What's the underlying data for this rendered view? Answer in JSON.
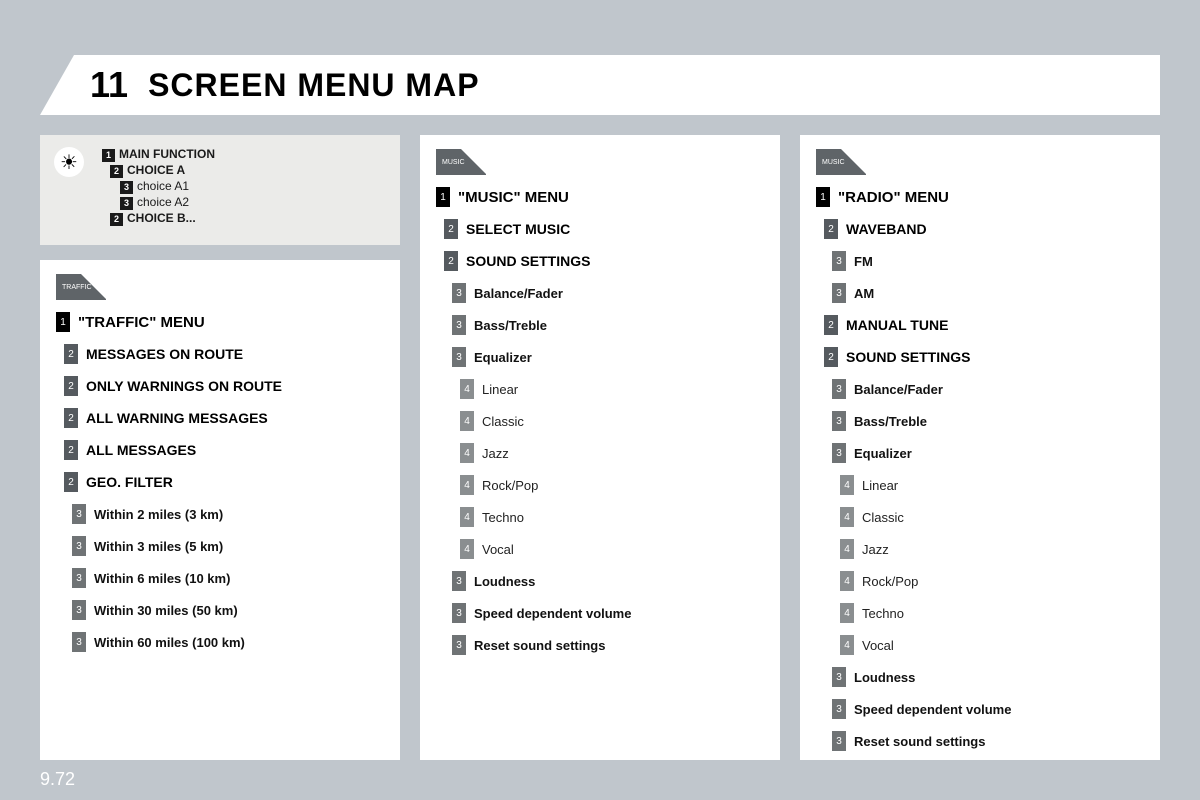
{
  "header": {
    "number": "11",
    "title": "SCREEN MENU MAP"
  },
  "legend": {
    "lines": [
      {
        "tag": "1",
        "text": "MAIN FUNCTION",
        "cls": ""
      },
      {
        "tag": "2",
        "text": "CHOICE A",
        "cls": "d2"
      },
      {
        "tag": "3",
        "text": "choice A1",
        "cls": "d3 leg3"
      },
      {
        "tag": "3",
        "text": "choice A2",
        "cls": "d3 leg3"
      },
      {
        "tag": "2",
        "text": "CHOICE B...",
        "cls": "d2"
      }
    ]
  },
  "panels": {
    "left": {
      "icon_label": "TRAFFIC",
      "items": [
        {
          "lvl": 1,
          "text": "\"TRAFFIC\" MENU",
          "style": "title"
        },
        {
          "lvl": 2,
          "text": "MESSAGES ON ROUTE",
          "style": "bold"
        },
        {
          "lvl": 2,
          "text": "ONLY WARNINGS ON ROUTE",
          "style": "bold"
        },
        {
          "lvl": 2,
          "text": "ALL WARNING MESSAGES",
          "style": "bold"
        },
        {
          "lvl": 2,
          "text": "ALL MESSAGES",
          "style": "bold"
        },
        {
          "lvl": 2,
          "text": "GEO. FILTER",
          "style": "bold"
        },
        {
          "lvl": 3,
          "text": "Within 2 miles (3 km)",
          "style": "sub"
        },
        {
          "lvl": 3,
          "text": "Within 3 miles (5 km)",
          "style": "sub"
        },
        {
          "lvl": 3,
          "text": "Within 6 miles (10 km)",
          "style": "sub"
        },
        {
          "lvl": 3,
          "text": "Within 30 miles (50 km)",
          "style": "sub"
        },
        {
          "lvl": 3,
          "text": "Within 60 miles (100 km)",
          "style": "sub"
        }
      ]
    },
    "mid": {
      "icon_label": "MUSIC",
      "items": [
        {
          "lvl": 1,
          "text": "\"MUSIC\" MENU",
          "style": "title"
        },
        {
          "lvl": 2,
          "text": "SELECT MUSIC",
          "style": "bold"
        },
        {
          "lvl": 2,
          "text": "SOUND SETTINGS",
          "style": "bold"
        },
        {
          "lvl": 3,
          "text": "Balance/Fader",
          "style": "sub"
        },
        {
          "lvl": 3,
          "text": "Bass/Treble",
          "style": "sub"
        },
        {
          "lvl": 3,
          "text": "Equalizer",
          "style": "sub"
        },
        {
          "lvl": 4,
          "text": "Linear",
          "style": "thin"
        },
        {
          "lvl": 4,
          "text": "Classic",
          "style": "thin"
        },
        {
          "lvl": 4,
          "text": "Jazz",
          "style": "thin"
        },
        {
          "lvl": 4,
          "text": "Rock/Pop",
          "style": "thin"
        },
        {
          "lvl": 4,
          "text": "Techno",
          "style": "thin"
        },
        {
          "lvl": 4,
          "text": "Vocal",
          "style": "thin"
        },
        {
          "lvl": 3,
          "text": "Loudness",
          "style": "sub"
        },
        {
          "lvl": 3,
          "text": "Speed dependent volume",
          "style": "sub"
        },
        {
          "lvl": 3,
          "text": "Reset sound settings",
          "style": "sub"
        }
      ]
    },
    "right": {
      "icon_label": "MUSIC",
      "items": [
        {
          "lvl": 1,
          "text": "\"RADIO\" MENU",
          "style": "title"
        },
        {
          "lvl": 2,
          "text": "WAVEBAND",
          "style": "bold"
        },
        {
          "lvl": 3,
          "text": "FM",
          "style": "sub"
        },
        {
          "lvl": 3,
          "text": "AM",
          "style": "sub"
        },
        {
          "lvl": 2,
          "text": "MANUAL TUNE",
          "style": "bold"
        },
        {
          "lvl": 2,
          "text": "SOUND SETTINGS",
          "style": "bold"
        },
        {
          "lvl": 3,
          "text": "Balance/Fader",
          "style": "sub"
        },
        {
          "lvl": 3,
          "text": "Bass/Treble",
          "style": "sub"
        },
        {
          "lvl": 3,
          "text": "Equalizer",
          "style": "sub"
        },
        {
          "lvl": 4,
          "text": "Linear",
          "style": "thin"
        },
        {
          "lvl": 4,
          "text": "Classic",
          "style": "thin"
        },
        {
          "lvl": 4,
          "text": "Jazz",
          "style": "thin"
        },
        {
          "lvl": 4,
          "text": "Rock/Pop",
          "style": "thin"
        },
        {
          "lvl": 4,
          "text": "Techno",
          "style": "thin"
        },
        {
          "lvl": 4,
          "text": "Vocal",
          "style": "thin"
        },
        {
          "lvl": 3,
          "text": "Loudness",
          "style": "sub"
        },
        {
          "lvl": 3,
          "text": "Speed dependent volume",
          "style": "sub"
        },
        {
          "lvl": 3,
          "text": "Reset sound settings",
          "style": "sub"
        }
      ]
    }
  },
  "footer": "9.72"
}
